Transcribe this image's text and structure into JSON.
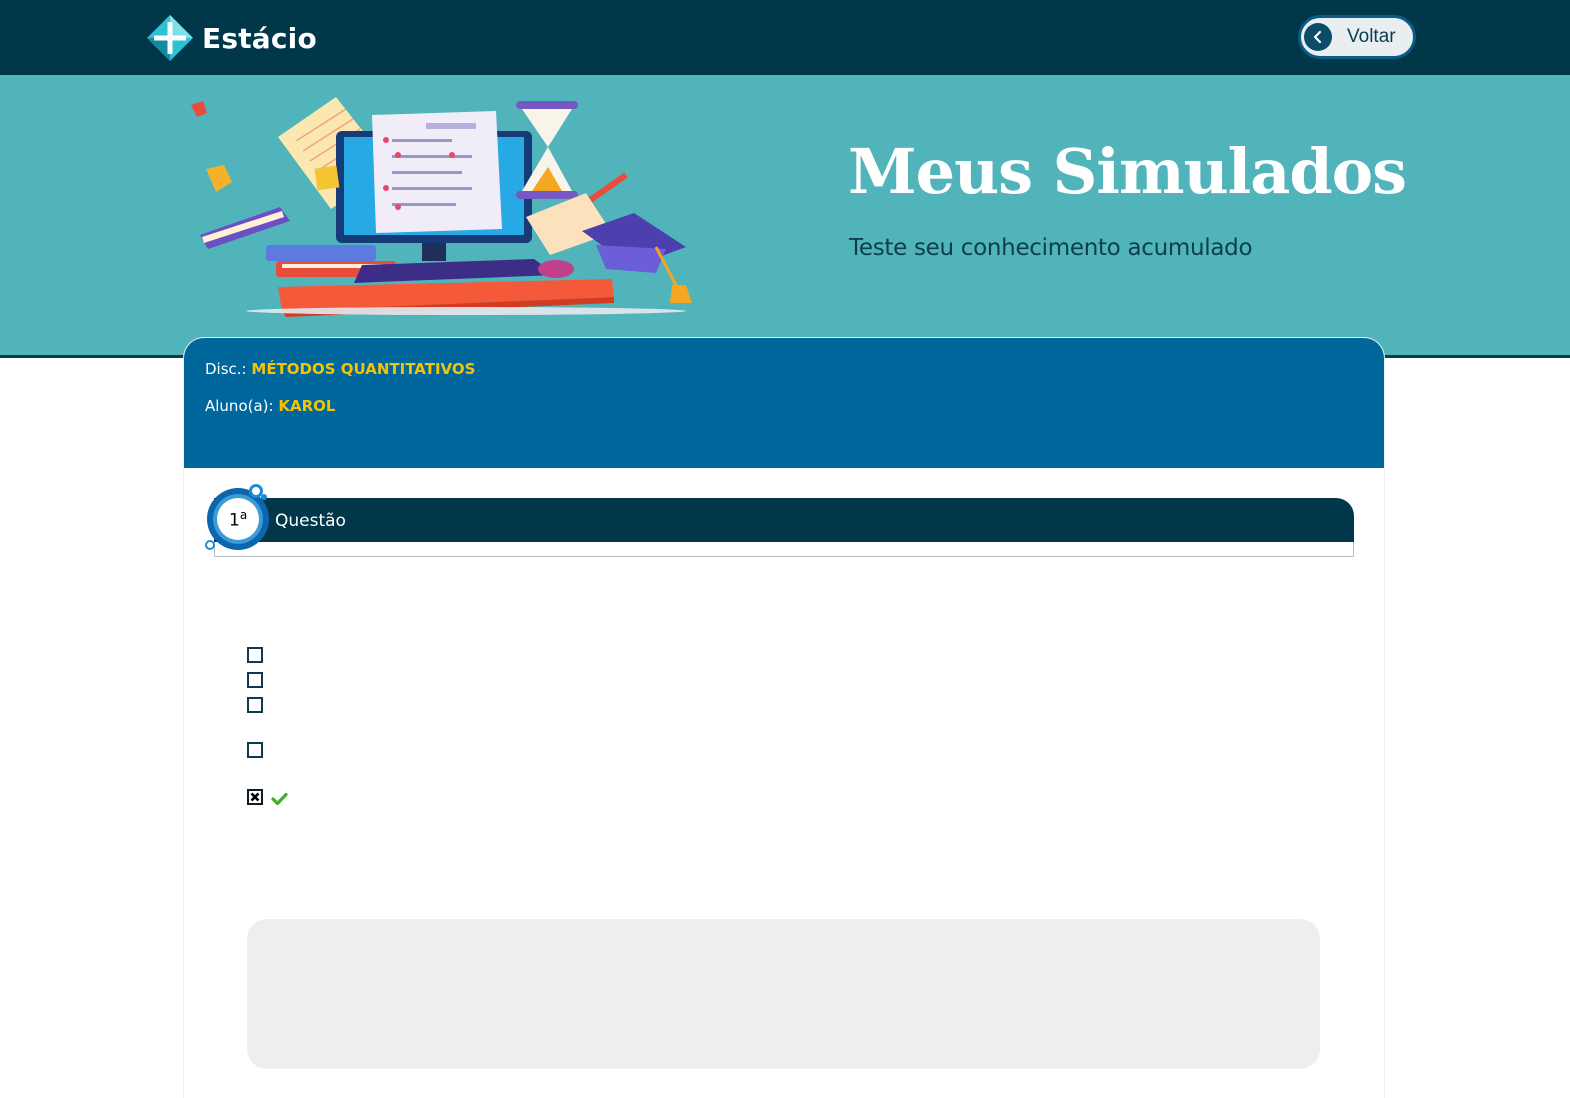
{
  "header": {
    "logo_text": "Estácio",
    "back_label": "Voltar",
    "back_icon": "chevron-left-icon"
  },
  "banner": {
    "title": "Meus Simulados",
    "subtitle": "Teste seu conhecimento acumulado",
    "illustration": "study-computer-illustration"
  },
  "info": {
    "disc_label": "Disc.:",
    "disc_value": "MÉTODOS QUANTITATIVOS",
    "student_label": "Aluno(a):",
    "student_value": "KAROL"
  },
  "question": {
    "number": "1",
    "ordinal": "a",
    "label": "Questão",
    "options": [
      {
        "checked": false
      },
      {
        "checked": false
      },
      {
        "checked": false
      },
      {
        "checked": false
      },
      {
        "checked": true,
        "correct": true
      }
    ]
  },
  "colors": {
    "topbar": "#00384a",
    "banner": "#50b4ba",
    "card_header": "#00679c",
    "highlight": "#f5c400",
    "question_bar": "#00374a",
    "correct": "#3fae2a"
  }
}
